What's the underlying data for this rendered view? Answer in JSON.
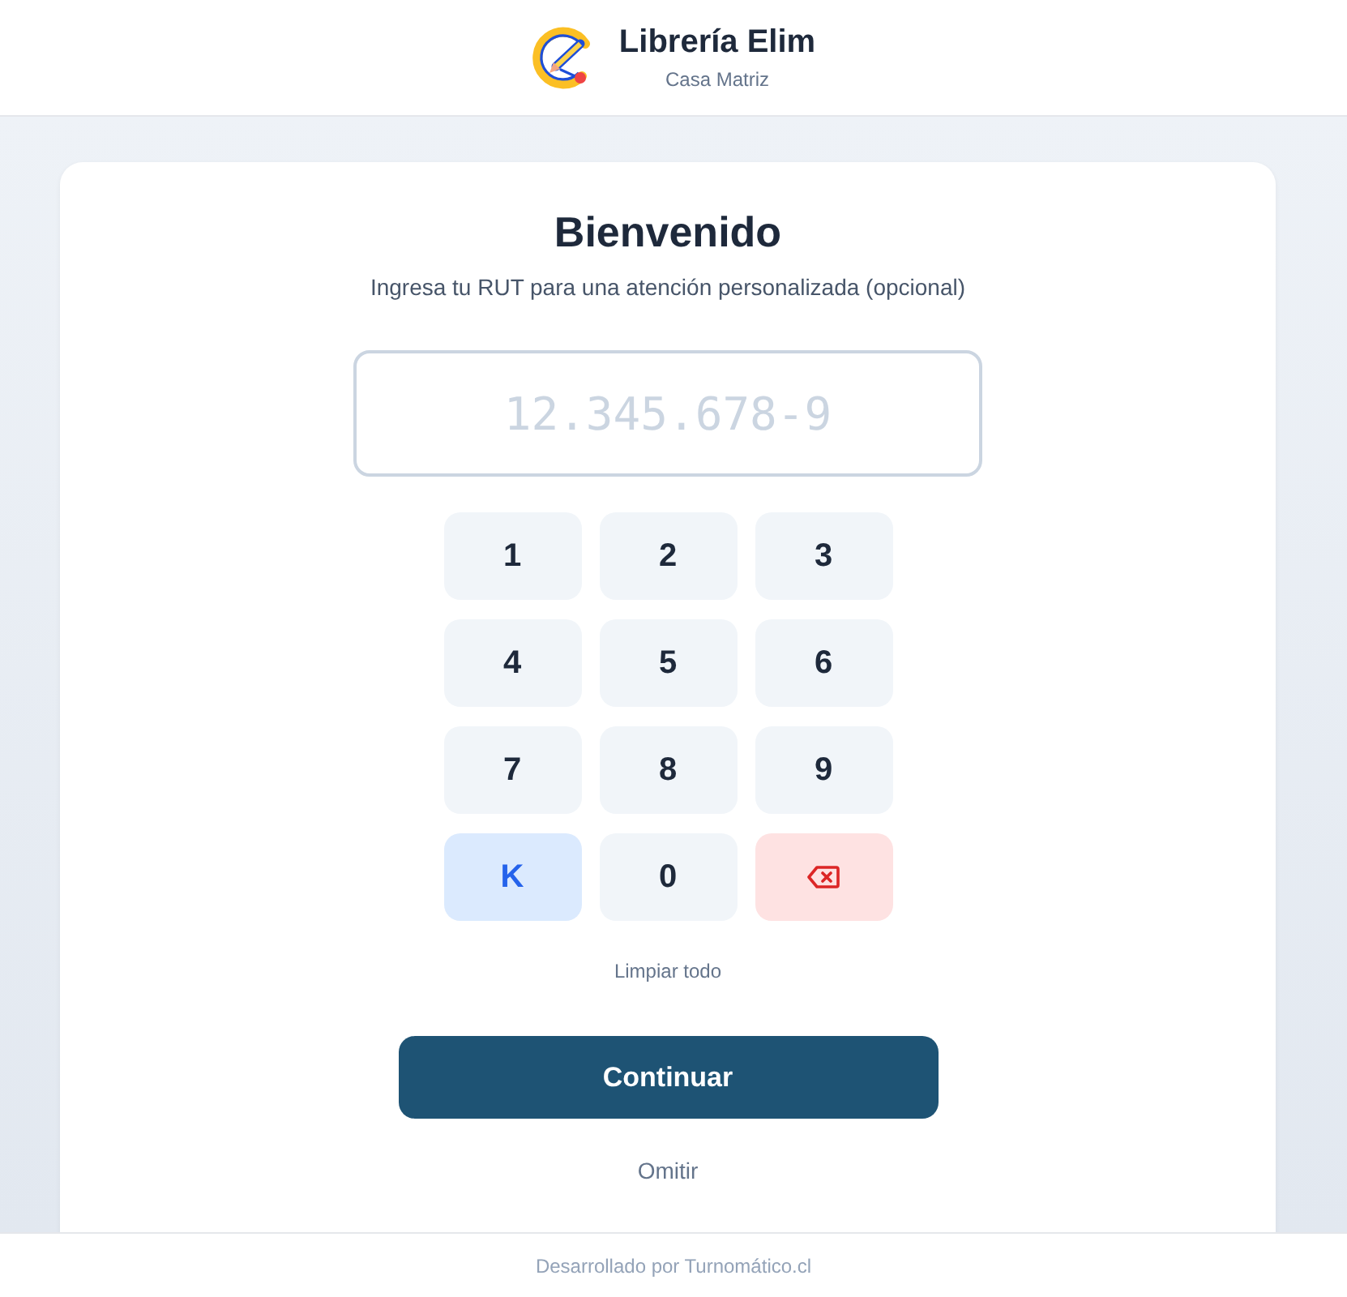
{
  "header": {
    "title": "Librería Elim",
    "subtitle": "Casa Matriz"
  },
  "card": {
    "title": "Bienvenido",
    "subtitle": "Ingresa tu RUT para una atención personalizada (opcional)"
  },
  "rut_field": {
    "placeholder": "12.345.678-9"
  },
  "keypad": [
    {
      "kind": "digit",
      "label": "1"
    },
    {
      "kind": "digit",
      "label": "2"
    },
    {
      "kind": "digit",
      "label": "3"
    },
    {
      "kind": "digit",
      "label": "4"
    },
    {
      "kind": "digit",
      "label": "5"
    },
    {
      "kind": "digit",
      "label": "6"
    },
    {
      "kind": "digit",
      "label": "7"
    },
    {
      "kind": "digit",
      "label": "8"
    },
    {
      "kind": "digit",
      "label": "9"
    },
    {
      "kind": "letter",
      "label": "K"
    },
    {
      "kind": "digit",
      "label": "0"
    },
    {
      "kind": "backspace"
    }
  ],
  "clear_link": "Limpiar todo",
  "continue_button": "Continuar",
  "skip_link": "Omitir",
  "footer": "Desarrollado por Turnomático.cl"
}
